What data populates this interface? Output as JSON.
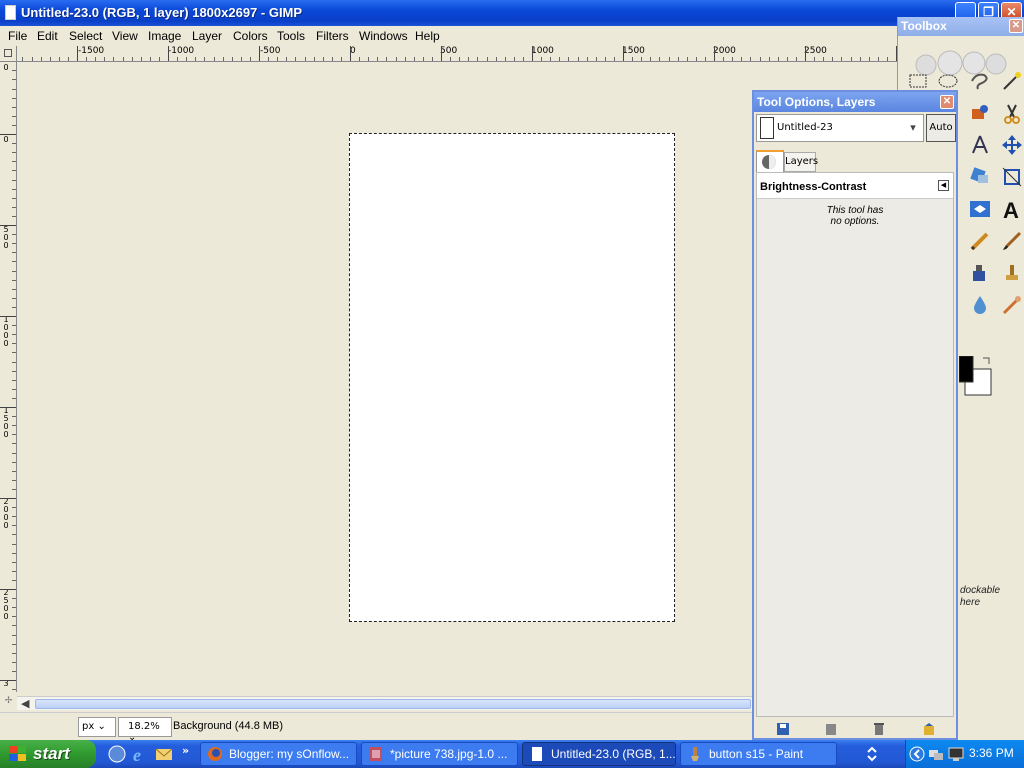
{
  "window": {
    "title": "Untitled-23.0 (RGB, 1 layer) 1800x2697 - GIMP",
    "minimize_glyph": "_",
    "maximize_glyph": "❐",
    "close_glyph": "✕"
  },
  "menubar": {
    "items": [
      "File",
      "Edit",
      "Select",
      "View",
      "Image",
      "Layer",
      "Colors",
      "Tools",
      "Filters",
      "Windows",
      "Help"
    ]
  },
  "ruler_h": {
    "labels": [
      "-1500",
      "-1000",
      "-500",
      "0",
      "500",
      "1000",
      "1500",
      "2000",
      "2500"
    ]
  },
  "ruler_v": {
    "labels": [
      "0",
      "0",
      "500",
      "1000",
      "1500",
      "2000",
      "2500",
      "3"
    ]
  },
  "statusbar": {
    "unit": "px",
    "zoom": "18.2%",
    "layer_info": "Background (44.8 MB)"
  },
  "toolbox": {
    "title": "Toolbox",
    "close_glyph": "✕",
    "dock_hint_line1": "dockable",
    "dock_hint_line2": "here",
    "tools": [
      "rect-select",
      "ellipse-select",
      "free-select",
      "fuzzy-select",
      "color-select",
      "scissors",
      "paths",
      "color-picker",
      "move",
      "align",
      "crop",
      "rotate",
      "flip",
      "text",
      "pencil",
      "paintbrush",
      "ink",
      "clone",
      "blur",
      "smudge"
    ],
    "fg_color": "#000000",
    "bg_color": "#ffffff"
  },
  "dock": {
    "title": "Tool Options, Layers",
    "close_glyph": "✕",
    "image_name": "Untitled-23",
    "auto_label": "Auto",
    "layers_tab": "Layers",
    "tool_name": "Brightness-Contrast",
    "no_options_line1": "This tool has",
    "no_options_line2": "no options."
  },
  "taskbar": {
    "start_label": "start",
    "quicklaunch_more": "»",
    "tasks": [
      {
        "label": "Blogger: my sOnflow...",
        "active": false
      },
      {
        "label": "*picture 738.jpg-1.0 ...",
        "active": false
      },
      {
        "label": "Untitled-23.0 (RGB, 1...",
        "active": true
      },
      {
        "label": "button s15 - Paint",
        "active": false
      }
    ],
    "clock": "3:36 PM"
  }
}
